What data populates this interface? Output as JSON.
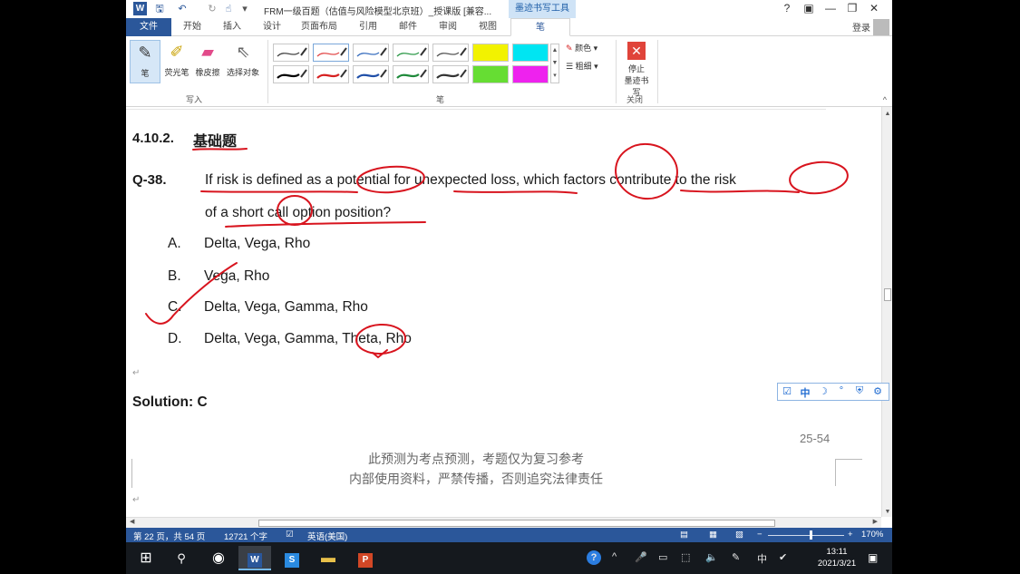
{
  "window": {
    "app_badge": "W",
    "doc_title": "FRM一级百题（估值与风险模型北京班）_授课版 [兼容...",
    "context_tab_title": "墨迹书写工具",
    "help": "?",
    "controls": [
      "▣",
      "—",
      "❐",
      "✕"
    ],
    "undo_icon": "↶",
    "redo_icon": "↻",
    "touch_icon": "☝",
    "save_icon": "🖫",
    "customize_icon": "▾"
  },
  "tabs": [
    "文件",
    "开始",
    "插入",
    "设计",
    "页面布局",
    "引用",
    "邮件",
    "审阅",
    "视图",
    "笔"
  ],
  "account": {
    "login": "登录"
  },
  "ribbon": {
    "write_group": {
      "label": "写入",
      "pen": "笔",
      "highlighter": "荧光笔",
      "eraser": "橡皮擦",
      "select": "选择对象"
    },
    "pens_group": {
      "label": "笔"
    },
    "pen_colors_top": [
      "#444444",
      "#e34c4c",
      "#3a6fbf",
      "#2f9a4a",
      "#555555",
      "#f2f200",
      "#00e5f2"
    ],
    "pen_colors_bottom": [
      "#000000",
      "#d62020",
      "#1f4fa8",
      "#1f8a3a",
      "#333333",
      "#66dd33",
      "#ee22ee"
    ],
    "color": "颜色",
    "thickness": "粗细",
    "close_group": {
      "label": "关闭",
      "stop_line1": "停止",
      "stop_line2": "墨迹书写"
    },
    "collapse": "^"
  },
  "document": {
    "section_number": "4.10.2.",
    "section_title": "基础题",
    "question_label": "Q-38.",
    "question_line1": "If risk is defined as a potential for unexpected loss, which factors contribute to the risk",
    "question_line2": "of a short call option position?",
    "options": [
      {
        "letter": "A.",
        "text": "Delta, Vega, Rho"
      },
      {
        "letter": "B.",
        "text": "Vega, Rho"
      },
      {
        "letter": "C.",
        "text": "Delta, Vega, Gamma, Rho"
      },
      {
        "letter": "D.",
        "text": "Delta, Vega, Gamma, Theta, Rho"
      }
    ],
    "solution": "Solution: C",
    "page_number": "25-54",
    "footer_line1": "此预测为考点预测，考题仅为复习参考",
    "footer_line2": "内部使用资料，严禁传播，否则追究法律责任",
    "para_mark": "↵"
  },
  "ime": [
    "☑",
    "中",
    "☽",
    "°",
    "⛨",
    "⚙"
  ],
  "scrollbar": {
    "up": "▲",
    "down": "▼",
    "left": "◀",
    "right": "▶"
  },
  "statusbar": {
    "page": "第 22 页，共 54 页",
    "words": "12721 个字",
    "proof_icon": "☑",
    "language": "英语(美国)",
    "view_icons": [
      "▤",
      "▦",
      "▧"
    ],
    "zoom_minus": "−",
    "zoom_plus": "+",
    "zoom": "170%"
  },
  "taskbar": {
    "start": "⊞",
    "search": "⚲",
    "chrome": "◉",
    "word": "W",
    "ime_app": "S",
    "explorer": "▬",
    "ppt": "P",
    "tray": [
      "?",
      "^",
      "🎤",
      "▭",
      "⬚",
      "🔈",
      "✎",
      "中",
      "✔"
    ],
    "time": "13:11",
    "date": "2021/3/21",
    "notification": "▣"
  },
  "accent_colors": {
    "word_blue": "#2b579a",
    "ink_red": "#d8141e"
  }
}
